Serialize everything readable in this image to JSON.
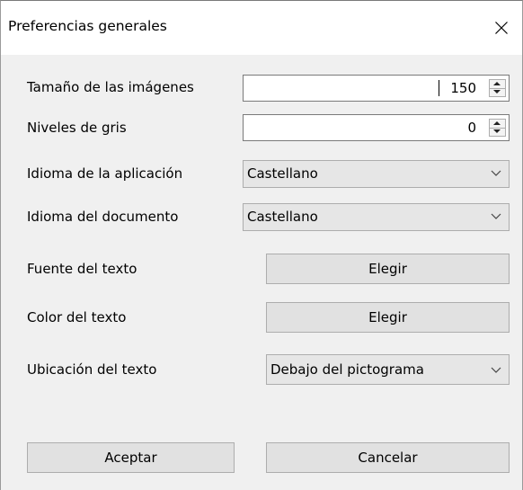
{
  "window": {
    "title": "Preferencias generales"
  },
  "fields": {
    "image_size": {
      "label": "Tamaño de las imágenes",
      "value": "150"
    },
    "gray_levels": {
      "label": "Niveles de gris",
      "value": "0"
    },
    "app_language": {
      "label": "Idioma de la aplicación",
      "value": "Castellano"
    },
    "doc_language": {
      "label": "Idioma del documento",
      "value": "Castellano"
    },
    "text_font": {
      "label": "Fuente del texto",
      "button_label": "Elegir"
    },
    "text_color": {
      "label": "Color del texto",
      "button_label": "Elegir"
    },
    "text_location": {
      "label": "Ubicación del texto",
      "value": "Debajo del pictograma"
    }
  },
  "actions": {
    "accept_label": "Aceptar",
    "cancel_label": "Cancelar"
  },
  "icons": {
    "close": "close-icon",
    "spin_up": "spin-up-icon",
    "spin_down": "spin-down-icon",
    "dropdown": "chevron-down-icon"
  },
  "colors": {
    "window_bg": "#f0f0f0",
    "titlebar_bg": "#ffffff",
    "button_bg": "#e1e1e1",
    "border": "#adadad"
  }
}
